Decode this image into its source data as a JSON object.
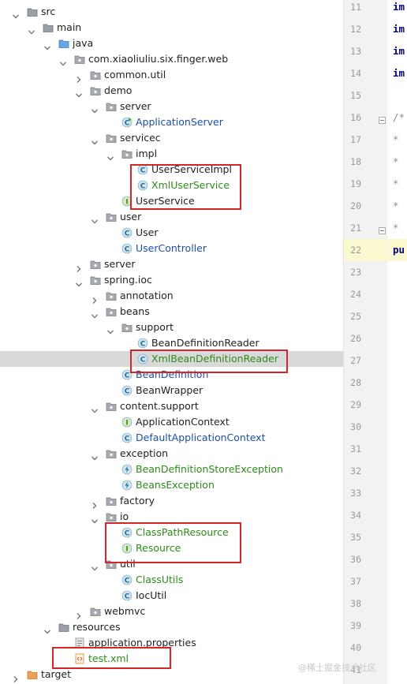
{
  "tree": [
    {
      "label": "src",
      "kind": "folder",
      "depth": 0,
      "expanded": true,
      "color": "default"
    },
    {
      "label": "main",
      "kind": "folder",
      "depth": 1,
      "expanded": true,
      "color": "default"
    },
    {
      "label": "java",
      "kind": "folder-src",
      "depth": 2,
      "expanded": true,
      "color": "default"
    },
    {
      "label": "com.xiaoliuliu.six.finger.web",
      "kind": "package",
      "depth": 3,
      "expanded": true,
      "color": "default"
    },
    {
      "label": "common.util",
      "kind": "package",
      "depth": 4,
      "expanded": false,
      "color": "default"
    },
    {
      "label": "demo",
      "kind": "package",
      "depth": 4,
      "expanded": true,
      "color": "default"
    },
    {
      "label": "server",
      "kind": "package",
      "depth": 5,
      "expanded": true,
      "color": "default"
    },
    {
      "label": "ApplicationServer",
      "kind": "class-run",
      "depth": 6,
      "color": "blue"
    },
    {
      "label": "servicec",
      "kind": "package",
      "depth": 5,
      "expanded": true,
      "color": "default"
    },
    {
      "label": "impl",
      "kind": "package",
      "depth": 6,
      "expanded": true,
      "color": "default"
    },
    {
      "label": "UserServiceImpl",
      "kind": "class",
      "depth": 7,
      "color": "default"
    },
    {
      "label": "XmlUserService",
      "kind": "class",
      "depth": 7,
      "color": "green"
    },
    {
      "label": "UserService",
      "kind": "interface",
      "depth": 6,
      "color": "default"
    },
    {
      "label": "user",
      "kind": "package",
      "depth": 5,
      "expanded": true,
      "color": "default"
    },
    {
      "label": "User",
      "kind": "class",
      "depth": 6,
      "color": "default"
    },
    {
      "label": "UserController",
      "kind": "class",
      "depth": 6,
      "color": "blue"
    },
    {
      "label": "server",
      "kind": "package",
      "depth": 4,
      "expanded": false,
      "color": "default"
    },
    {
      "label": "spring.ioc",
      "kind": "package",
      "depth": 4,
      "expanded": true,
      "color": "default"
    },
    {
      "label": "annotation",
      "kind": "package",
      "depth": 5,
      "expanded": false,
      "color": "default"
    },
    {
      "label": "beans",
      "kind": "package",
      "depth": 5,
      "expanded": true,
      "color": "default"
    },
    {
      "label": "support",
      "kind": "package",
      "depth": 6,
      "expanded": true,
      "color": "default"
    },
    {
      "label": "BeanDefinitionReader",
      "kind": "class",
      "depth": 7,
      "color": "default"
    },
    {
      "label": "XmlBeanDefinitionReader",
      "kind": "class",
      "depth": 7,
      "color": "green",
      "selected": true
    },
    {
      "label": "BeanDefinition",
      "kind": "class",
      "depth": 6,
      "color": "blue"
    },
    {
      "label": "BeanWrapper",
      "kind": "class",
      "depth": 6,
      "color": "default"
    },
    {
      "label": "content.support",
      "kind": "package",
      "depth": 5,
      "expanded": true,
      "color": "default"
    },
    {
      "label": "ApplicationContext",
      "kind": "interface",
      "depth": 6,
      "color": "default"
    },
    {
      "label": "DefaultApplicationContext",
      "kind": "class",
      "depth": 6,
      "color": "blue"
    },
    {
      "label": "exception",
      "kind": "package",
      "depth": 5,
      "expanded": true,
      "color": "default"
    },
    {
      "label": "BeanDefinitionStoreException",
      "kind": "exception",
      "depth": 6,
      "color": "green"
    },
    {
      "label": "BeansException",
      "kind": "exception",
      "depth": 6,
      "color": "green"
    },
    {
      "label": "factory",
      "kind": "package",
      "depth": 5,
      "expanded": false,
      "color": "default"
    },
    {
      "label": "io",
      "kind": "package",
      "depth": 5,
      "expanded": true,
      "color": "default"
    },
    {
      "label": "ClassPathResource",
      "kind": "class",
      "depth": 6,
      "color": "green"
    },
    {
      "label": "Resource",
      "kind": "interface",
      "depth": 6,
      "color": "green"
    },
    {
      "label": "util",
      "kind": "package",
      "depth": 5,
      "expanded": true,
      "color": "default"
    },
    {
      "label": "ClassUtils",
      "kind": "class",
      "depth": 6,
      "color": "green"
    },
    {
      "label": "IocUtil",
      "kind": "class",
      "depth": 6,
      "color": "default"
    },
    {
      "label": "webmvc",
      "kind": "package",
      "depth": 4,
      "expanded": false,
      "color": "default"
    },
    {
      "label": "resources",
      "kind": "folder-res",
      "depth": 2,
      "expanded": true,
      "color": "default"
    },
    {
      "label": "application.properties",
      "kind": "properties",
      "depth": 3,
      "color": "default"
    },
    {
      "label": "test.xml",
      "kind": "xml",
      "depth": 3,
      "color": "green"
    },
    {
      "label": "target",
      "kind": "folder-target",
      "depth": 0,
      "expanded": false,
      "color": "default"
    }
  ],
  "gutter": [
    {
      "line": "11",
      "code": "im"
    },
    {
      "line": "12",
      "code": "im"
    },
    {
      "line": "13",
      "code": "im"
    },
    {
      "line": "14",
      "code": "im"
    },
    {
      "line": "15",
      "code": ""
    },
    {
      "line": "16",
      "code": "/*"
    },
    {
      "line": "17",
      "code": " *"
    },
    {
      "line": "18",
      "code": " *"
    },
    {
      "line": "19",
      "code": " *"
    },
    {
      "line": "20",
      "code": " *"
    },
    {
      "line": "21",
      "code": " *"
    },
    {
      "line": "22",
      "code": "pu",
      "current": true
    },
    {
      "line": "23",
      "code": ""
    },
    {
      "line": "24",
      "code": ""
    },
    {
      "line": "25",
      "code": ""
    },
    {
      "line": "26",
      "code": ""
    },
    {
      "line": "27",
      "code": ""
    },
    {
      "line": "28",
      "code": ""
    },
    {
      "line": "29",
      "code": ""
    },
    {
      "line": "30",
      "code": ""
    },
    {
      "line": "31",
      "code": ""
    },
    {
      "line": "32",
      "code": ""
    },
    {
      "line": "33",
      "code": ""
    },
    {
      "line": "34",
      "code": ""
    },
    {
      "line": "35",
      "code": ""
    },
    {
      "line": "36",
      "code": ""
    },
    {
      "line": "37",
      "code": ""
    },
    {
      "line": "38",
      "code": ""
    },
    {
      "line": "39",
      "code": ""
    },
    {
      "line": "40",
      "code": ""
    },
    {
      "line": "41",
      "code": ""
    }
  ],
  "highlight_colors": {
    "box": "#d32626",
    "selection": "#d9d9d9",
    "current_line": "#fbf7cf"
  },
  "watermark": "@稀土掘金技术社区"
}
